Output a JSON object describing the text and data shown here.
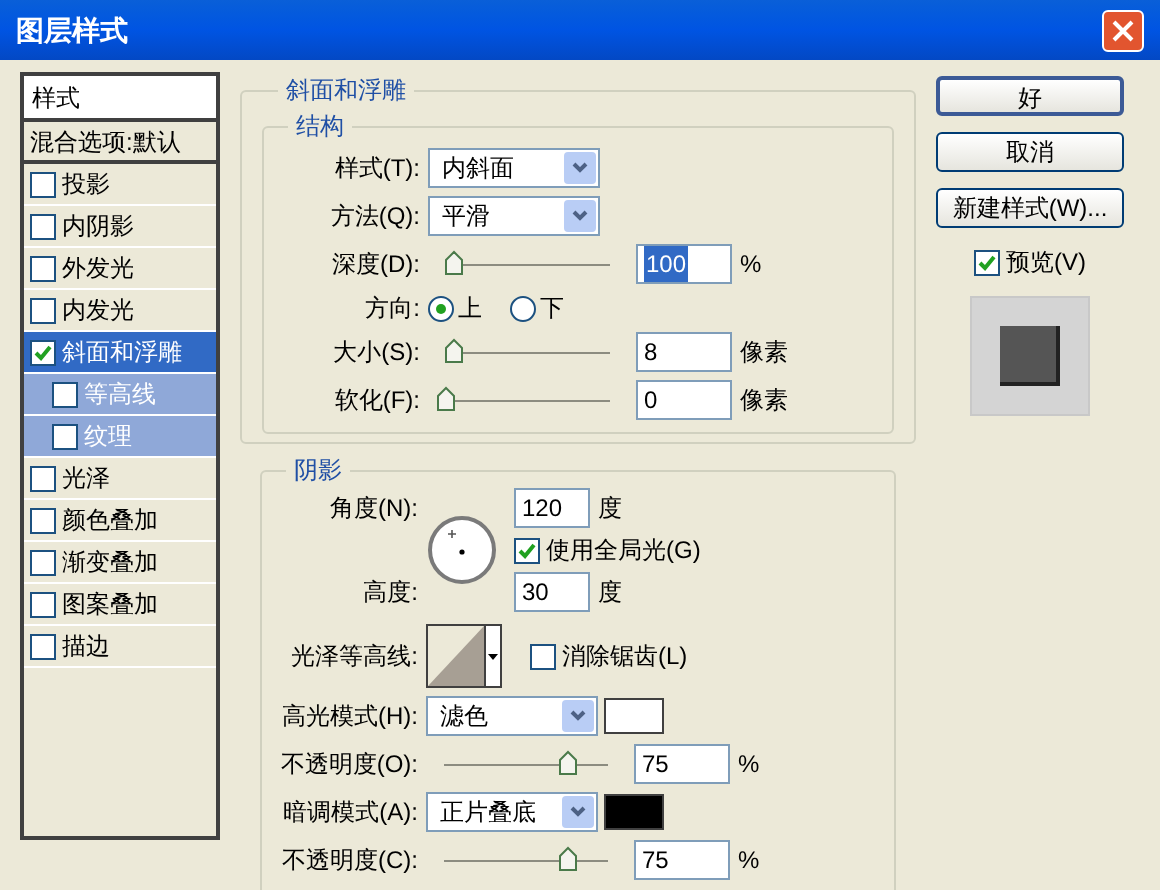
{
  "window": {
    "title": "图层样式"
  },
  "styles_list": {
    "header": "样式",
    "items": [
      {
        "label": "混合选项:默认",
        "kind": "plain",
        "selected": false
      },
      {
        "label": "投影",
        "kind": "check",
        "checked": false,
        "selected": false
      },
      {
        "label": "内阴影",
        "kind": "check",
        "checked": false,
        "selected": false
      },
      {
        "label": "外发光",
        "kind": "check",
        "checked": false,
        "selected": false
      },
      {
        "label": "内发光",
        "kind": "check",
        "checked": false,
        "selected": false
      },
      {
        "label": "斜面和浮雕",
        "kind": "check",
        "checked": true,
        "selected": true,
        "children": [
          {
            "label": "等高线",
            "kind": "check",
            "checked": false,
            "selected": false
          },
          {
            "label": "纹理",
            "kind": "check",
            "checked": false,
            "selected": false
          }
        ]
      },
      {
        "label": "光泽",
        "kind": "check",
        "checked": false,
        "selected": false
      },
      {
        "label": "颜色叠加",
        "kind": "check",
        "checked": false,
        "selected": false
      },
      {
        "label": "渐变叠加",
        "kind": "check",
        "checked": false,
        "selected": false
      },
      {
        "label": "图案叠加",
        "kind": "check",
        "checked": false,
        "selected": false
      },
      {
        "label": "描边",
        "kind": "check",
        "checked": false,
        "selected": false
      }
    ]
  },
  "bevel": {
    "title": "斜面和浮雕",
    "structure": {
      "title": "结构",
      "style": {
        "label": "样式(T):",
        "value": "内斜面"
      },
      "technique": {
        "label": "方法(Q):",
        "value": "平滑"
      },
      "depth": {
        "label": "深度(D):",
        "level": 0.05,
        "value": "100",
        "unit": "%",
        "text_selected": true
      },
      "direction": {
        "label": "方向:",
        "options": [
          {
            "label": "上",
            "selected": true
          },
          {
            "label": "下",
            "selected": false
          }
        ]
      },
      "size": {
        "label": "大小(S):",
        "level": 0.05,
        "value": "8",
        "unit": "像素",
        "text_selected": false
      },
      "soften": {
        "label": "软化(F):",
        "level": 0,
        "value": "0",
        "unit": "像素",
        "text_selected": false
      }
    },
    "shading": {
      "title": "阴影",
      "angle": {
        "label": "角度(N):",
        "value": "120",
        "unit": "度"
      },
      "global_light": {
        "label": "使用全局光(G)",
        "checked": true
      },
      "altitude": {
        "label": "高度:",
        "value": "30",
        "unit": "度"
      },
      "gloss_contour": {
        "label": "光泽等高线:"
      },
      "anti_aliased": {
        "label": "消除锯齿(L)",
        "checked": false
      },
      "highlight_mode": {
        "label": "高光模式(H):",
        "value": "滤色",
        "color": "#ffffff"
      },
      "highlight_opacity": {
        "label": "不透明度(O):",
        "level": 0.75,
        "value": "75",
        "unit": "%",
        "text_selected": false
      },
      "shadow_mode": {
        "label": "暗调模式(A):",
        "value": "正片叠底",
        "color": "#000000"
      },
      "shadow_opacity": {
        "label": "不透明度(C):",
        "level": 0.75,
        "value": "75",
        "unit": "%",
        "text_selected": false
      }
    }
  },
  "buttons": [
    {
      "label": "好",
      "default": true
    },
    {
      "label": "取消",
      "default": false
    },
    {
      "label": "新建样式(W)...",
      "default": false
    }
  ],
  "preview": {
    "label": "预览(V)",
    "checked": true
  }
}
